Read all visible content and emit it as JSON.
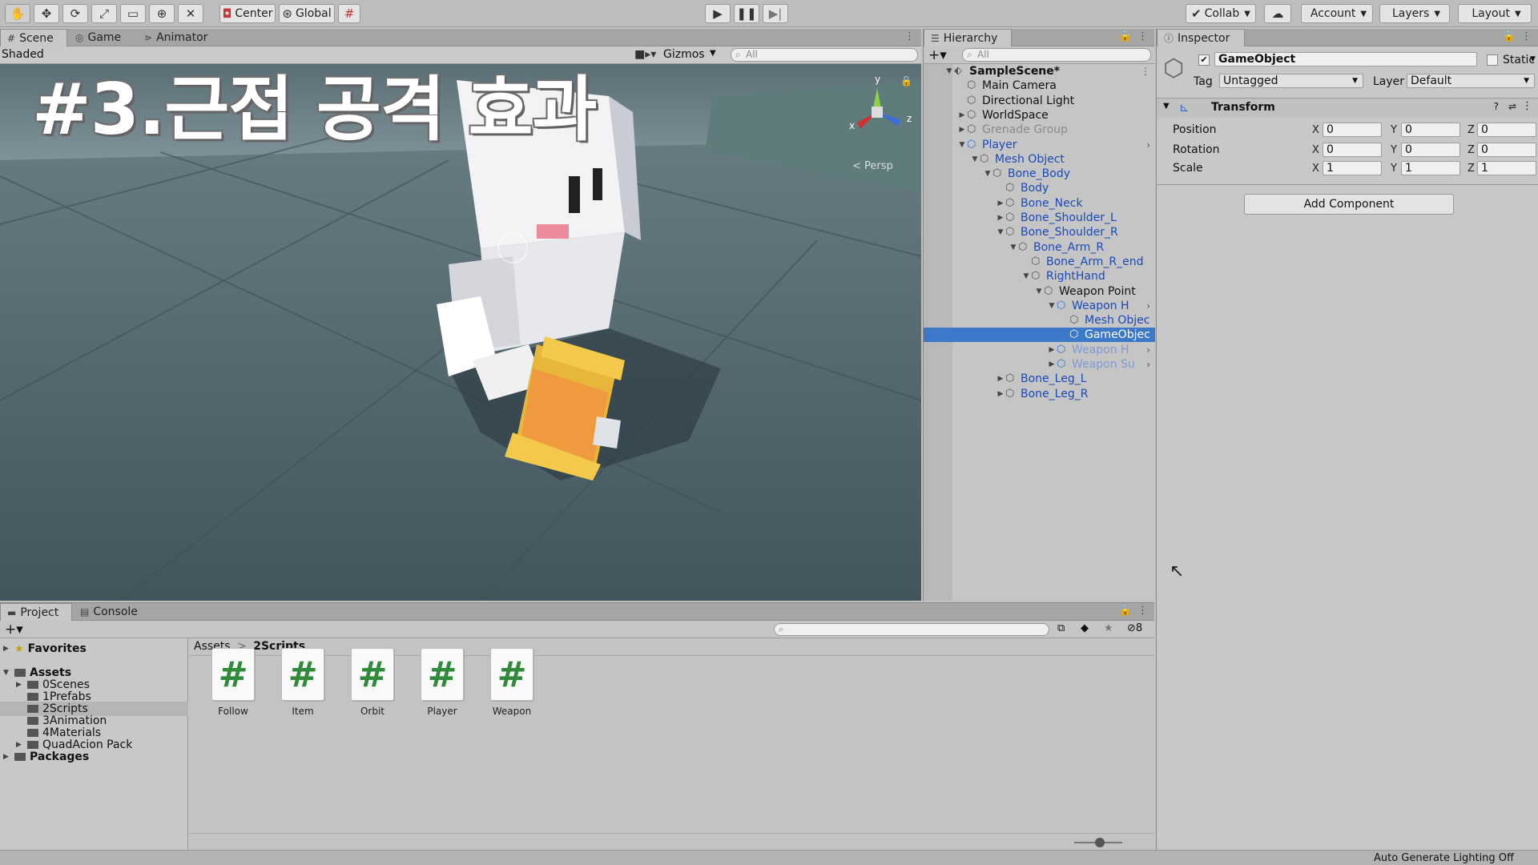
{
  "toolbar": {
    "pivot_label": "Center",
    "space_label": "Global",
    "collab_label": "Collab",
    "account_label": "Account",
    "layers_label": "Layers",
    "layout_label": "Layout"
  },
  "overlay": {
    "title": "#3.근접 공격 효과"
  },
  "scene": {
    "tabs": [
      "Scene",
      "Game",
      "Animator"
    ],
    "shading_mode": "Shaded",
    "gizmos_label": "Gizmos",
    "search_placeholder": "All",
    "persp_label": "< Persp",
    "axes": {
      "x": "x",
      "y": "y",
      "z": "z"
    }
  },
  "hierarchy": {
    "tab_label": "Hierarchy",
    "search_placeholder": "All",
    "rows": [
      {
        "label": "SampleScene*",
        "depth": 0,
        "arrow": "down",
        "style": "scene"
      },
      {
        "label": "Main Camera",
        "depth": 1,
        "arrow": "",
        "style": "normal"
      },
      {
        "label": "Directional Light",
        "depth": 1,
        "arrow": "",
        "style": "normal"
      },
      {
        "label": "WorldSpace",
        "depth": 1,
        "arrow": "right",
        "style": "normal"
      },
      {
        "label": "Grenade Group",
        "depth": 1,
        "arrow": "right",
        "style": "fade"
      },
      {
        "label": "Player",
        "depth": 1,
        "arrow": "down",
        "style": "blue",
        "chev": true
      },
      {
        "label": "Mesh Object",
        "depth": 2,
        "arrow": "down",
        "style": "blue"
      },
      {
        "label": "Bone_Body",
        "depth": 3,
        "arrow": "down",
        "style": "blue"
      },
      {
        "label": "Body",
        "depth": 4,
        "arrow": "",
        "style": "blue"
      },
      {
        "label": "Bone_Neck",
        "depth": 4,
        "arrow": "right",
        "style": "blue"
      },
      {
        "label": "Bone_Shoulder_L",
        "depth": 4,
        "arrow": "right",
        "style": "blue"
      },
      {
        "label": "Bone_Shoulder_R",
        "depth": 4,
        "arrow": "down",
        "style": "blue"
      },
      {
        "label": "Bone_Arm_R",
        "depth": 5,
        "arrow": "down",
        "style": "blue"
      },
      {
        "label": "Bone_Arm_R_end",
        "depth": 6,
        "arrow": "",
        "style": "blue"
      },
      {
        "label": "RightHand",
        "depth": 6,
        "arrow": "down",
        "style": "blue"
      },
      {
        "label": "Weapon Point",
        "depth": 7,
        "arrow": "down",
        "style": "normal"
      },
      {
        "label": "Weapon H",
        "depth": 8,
        "arrow": "down",
        "style": "blue",
        "chev": true
      },
      {
        "label": "Mesh Objec",
        "depth": 9,
        "arrow": "",
        "style": "blue"
      },
      {
        "label": "GameObjec",
        "depth": 9,
        "arrow": "",
        "style": "selected"
      },
      {
        "label": "Weapon H",
        "depth": 8,
        "arrow": "right",
        "style": "fadeblue",
        "chev": true
      },
      {
        "label": "Weapon Su",
        "depth": 8,
        "arrow": "right",
        "style": "fadeblue",
        "chev": true
      },
      {
        "label": "Bone_Leg_L",
        "depth": 4,
        "arrow": "right",
        "style": "blue"
      },
      {
        "label": "Bone_Leg_R",
        "depth": 4,
        "arrow": "right",
        "style": "blue"
      }
    ]
  },
  "inspector": {
    "tab_label": "Inspector",
    "object_name": "GameObject",
    "static_label": "Static",
    "tag_label": "Tag",
    "tag_value": "Untagged",
    "layer_label": "Layer",
    "layer_value": "Default",
    "transform_label": "Transform",
    "position_label": "Position",
    "rotation_label": "Rotation",
    "scale_label": "Scale",
    "position": {
      "x": "0",
      "y": "0",
      "z": "0"
    },
    "rotation": {
      "x": "0",
      "y": "0",
      "z": "0"
    },
    "scale": {
      "x": "1",
      "y": "1",
      "z": "1"
    },
    "add_component_label": "Add Component"
  },
  "project": {
    "tabs": [
      "Project",
      "Console"
    ],
    "breadcrumb": {
      "root": "Assets",
      "separator": ">",
      "current": "2Scripts"
    },
    "hidden_count": "8",
    "tree": [
      {
        "label": "Favorites",
        "type": "favorites",
        "depth": 0,
        "arrow": "right"
      },
      {
        "label": "Assets",
        "type": "root",
        "depth": 0,
        "arrow": "down"
      },
      {
        "label": "0Scenes",
        "type": "folder",
        "depth": 1,
        "arrow": "right"
      },
      {
        "label": "1Prefabs",
        "type": "folder",
        "depth": 1,
        "arrow": ""
      },
      {
        "label": "2Scripts",
        "type": "folder",
        "depth": 1,
        "arrow": "",
        "selected": true
      },
      {
        "label": "3Animation",
        "type": "folder",
        "depth": 1,
        "arrow": ""
      },
      {
        "label": "4Materials",
        "type": "folder",
        "depth": 1,
        "arrow": ""
      },
      {
        "label": "QuadAcion Pack",
        "type": "folder",
        "depth": 1,
        "arrow": "right"
      },
      {
        "label": "Packages",
        "type": "root",
        "depth": 0,
        "arrow": "right"
      }
    ],
    "scripts": [
      "Follow",
      "Item",
      "Orbit",
      "Player",
      "Weapon"
    ]
  },
  "status": {
    "text": "Auto Generate Lighting Off"
  }
}
